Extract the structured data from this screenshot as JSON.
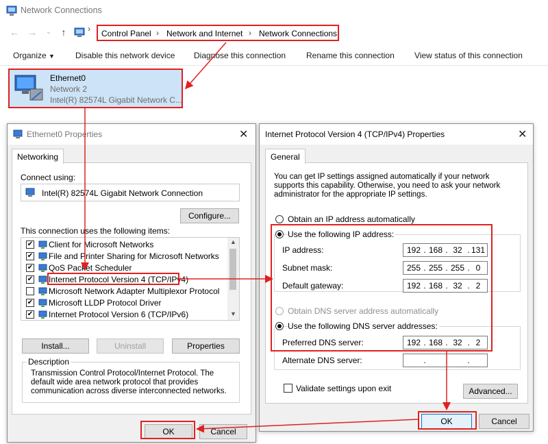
{
  "explorer": {
    "title": "Network Connections",
    "breadcrumb": [
      "Control Panel",
      "Network and Internet",
      "Network Connections"
    ],
    "commands": [
      "Organize",
      "Disable this network device",
      "Diagnose this connection",
      "Rename this connection",
      "View status of this connection"
    ],
    "adapter": {
      "name": "Ethernet0",
      "network": "Network 2",
      "device": "Intel(R) 82574L Gigabit Network C..."
    }
  },
  "eth_props": {
    "title": "Ethernet0 Properties",
    "tab": "Networking",
    "connect_using_label": "Connect using:",
    "adapter_name": "Intel(R) 82574L Gigabit Network Connection",
    "configure_label": "Configure...",
    "items_label": "This connection uses the following items:",
    "items": [
      {
        "label": "Client for Microsoft Networks",
        "checked": true
      },
      {
        "label": "File and Printer Sharing for Microsoft Networks",
        "checked": true
      },
      {
        "label": "QoS Packet Scheduler",
        "checked": true
      },
      {
        "label": "Internet Protocol Version 4 (TCP/IPv4)",
        "checked": true
      },
      {
        "label": "Microsoft Network Adapter Multiplexor Protocol",
        "checked": false
      },
      {
        "label": "Microsoft LLDP Protocol Driver",
        "checked": true
      },
      {
        "label": "Internet Protocol Version 6 (TCP/IPv6)",
        "checked": true
      }
    ],
    "install_label": "Install...",
    "uninstall_label": "Uninstall",
    "properties_label": "Properties",
    "description_heading": "Description",
    "description_text": "Transmission Control Protocol/Internet Protocol. The default wide area network protocol that provides communication across diverse interconnected networks.",
    "ok_label": "OK",
    "cancel_label": "Cancel"
  },
  "ipv4": {
    "title": "Internet Protocol Version 4 (TCP/IPv4) Properties",
    "tab": "General",
    "intro": "You can get IP settings assigned automatically if your network supports this capability. Otherwise, you need to ask your network administrator for the appropriate IP settings.",
    "obtain_ip_auto": "Obtain an IP address automatically",
    "use_following_ip": "Use the following IP address:",
    "ip_label": "IP address:",
    "ip": [
      "192",
      "168",
      "32",
      "131"
    ],
    "mask_label": "Subnet mask:",
    "mask": [
      "255",
      "255",
      "255",
      "0"
    ],
    "gateway_label": "Default gateway:",
    "gateway": [
      "192",
      "168",
      "32",
      "2"
    ],
    "obtain_dns_auto": "Obtain DNS server address automatically",
    "use_following_dns": "Use the following DNS server addresses:",
    "preferred_dns_label": "Preferred DNS server:",
    "preferred_dns": [
      "192",
      "168",
      "32",
      "2"
    ],
    "alternate_dns_label": "Alternate DNS server:",
    "alternate_dns": [
      "",
      "",
      "",
      ""
    ],
    "validate_label": "Validate settings upon exit",
    "advanced_label": "Advanced...",
    "ok_label": "OK",
    "cancel_label": "Cancel"
  },
  "colors": {
    "highlight_red": "#e02020",
    "selection_blue": "#cde3f7",
    "dialog_bg": "#f0f0f0"
  }
}
